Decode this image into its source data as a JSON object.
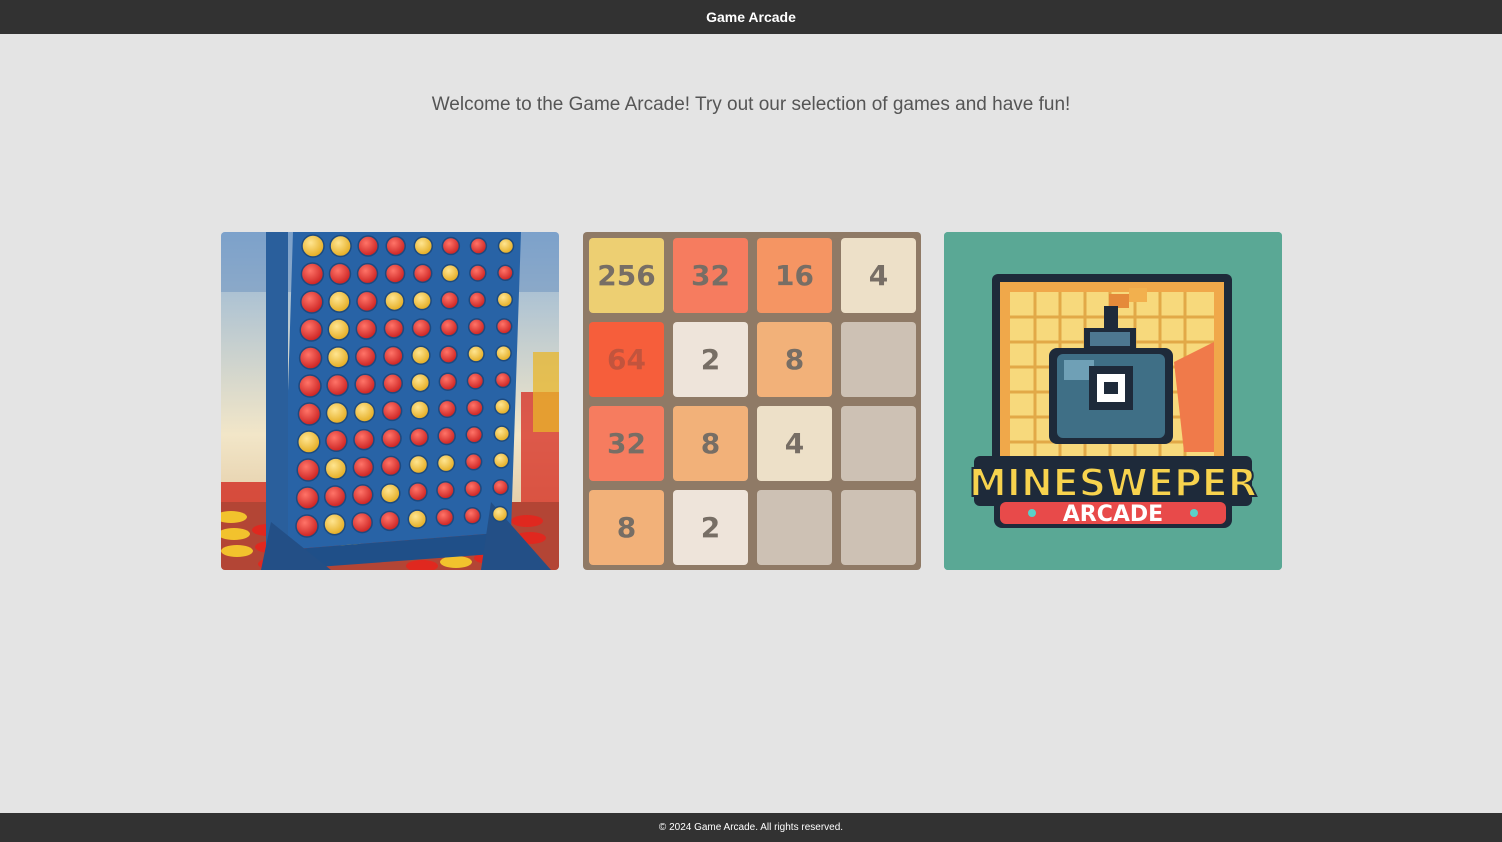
{
  "header": {
    "title": "Game Arcade"
  },
  "main": {
    "welcome": "Welcome to the Game Arcade! Try out our selection of games and have fun!"
  },
  "games": {
    "c4": {
      "image": "connect-four-board"
    },
    "g2048": {
      "tiles": [
        {
          "v": "256",
          "bg": "#edcf72",
          "fg": "#776e65"
        },
        {
          "v": "32",
          "bg": "#f67c5f",
          "fg": "#776e65"
        },
        {
          "v": "16",
          "bg": "#f59563",
          "fg": "#776e65"
        },
        {
          "v": "4",
          "bg": "#ede0c8",
          "fg": "#776e65"
        },
        {
          "v": "64",
          "bg": "#f65e3b",
          "fg": "#c2543d"
        },
        {
          "v": "2",
          "bg": "#eee4da",
          "fg": "#776e65"
        },
        {
          "v": "8",
          "bg": "#f2b179",
          "fg": "#776e65"
        },
        {
          "v": "",
          "bg": "#cdc1b4",
          "fg": "#776e65"
        },
        {
          "v": "32",
          "bg": "#f67c5f",
          "fg": "#776e65"
        },
        {
          "v": "8",
          "bg": "#f2b179",
          "fg": "#776e65"
        },
        {
          "v": "4",
          "bg": "#ede0c8",
          "fg": "#776e65"
        },
        {
          "v": "",
          "bg": "#cdc1b4",
          "fg": "#776e65"
        },
        {
          "v": "8",
          "bg": "#f2b179",
          "fg": "#776e65"
        },
        {
          "v": "2",
          "bg": "#eee4da",
          "fg": "#776e65"
        },
        {
          "v": "",
          "bg": "#cdc1b4",
          "fg": "#776e65"
        },
        {
          "v": "",
          "bg": "#cdc1b4",
          "fg": "#776e65"
        }
      ]
    },
    "mine": {
      "title_line1": "MINESWEPER",
      "title_line2": "ARCADE"
    }
  },
  "footer": {
    "text": "© 2024 Game Arcade. All rights reserved."
  },
  "colors": {
    "bar": "#323232",
    "page_bg": "#e4e4e4",
    "board_blue": "#2a6aa8",
    "disc_red": "#e8302c",
    "disc_yellow": "#f5c531",
    "mine_bg": "#5aa895"
  }
}
